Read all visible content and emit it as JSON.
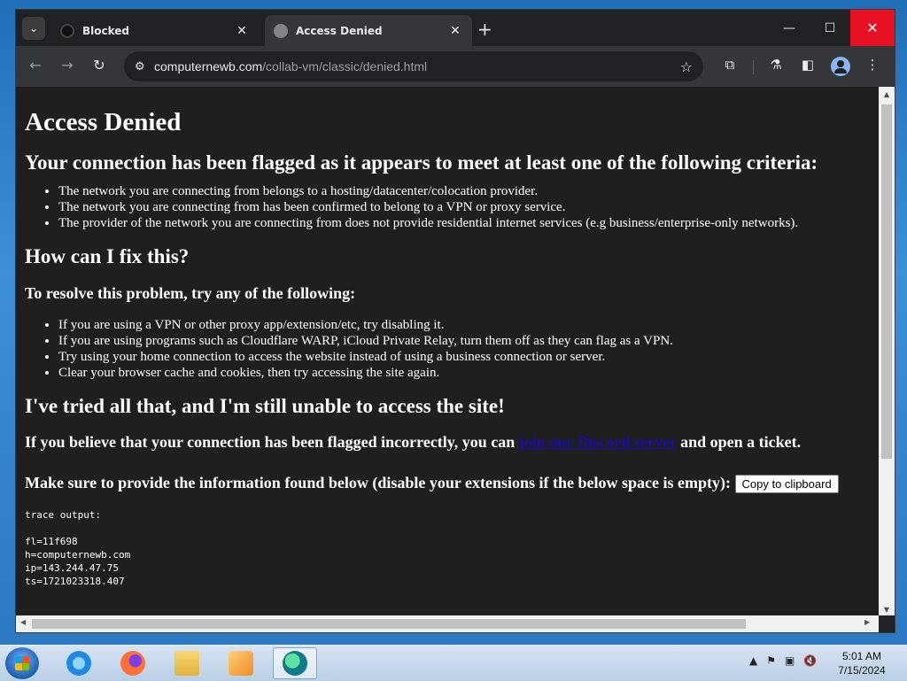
{
  "browser": {
    "tabs": [
      {
        "title": "Blocked",
        "active": false
      },
      {
        "title": "Access Denied",
        "active": true
      }
    ],
    "address_host": "computernewb.com",
    "address_path": "/collab-vm/classic/denied.html"
  },
  "page": {
    "title": "Access Denied",
    "criteria_heading": "Your connection has been flagged as it appears to meet at least one of the following criteria:",
    "criteria": [
      "The network you are connecting from belongs to a hosting/datacenter/colocation provider.",
      "The network you are connecting from has been confirmed to belong to a VPN or proxy service.",
      "The provider of the network you are connecting from does not provide residential internet services (e.g business/enterprise-only networks)."
    ],
    "fix_heading": "How can I fix this?",
    "resolve_heading": "To resolve this problem, try any of the following:",
    "fixes": [
      "If you are using a VPN or other proxy app/extension/etc, try disabling it.",
      "If you are using programs such as Cloudflare WARP, iCloud Private Relay, turn them off as they can flag as a VPN.",
      "Try using your home connection to access the website instead of using a business connection or server.",
      "Clear your browser cache and cookies, then try accessing the site again."
    ],
    "tried_heading": "I've tried all that, and I'm still unable to access the site!",
    "ticket_prefix": "If you believe that your connection has been flagged incorrectly, you can",
    "ticket_link": "join our Discord server",
    "ticket_suffix": "and open a ticket.",
    "info_text": "Make sure to provide the information found below (disable your extensions if the below space is empty):",
    "copy_button": "Copy to clipboard",
    "trace": "trace output:\n\nfl=11f698\nh=computernewb.com\nip=143.244.47.75\nts=1721023318.407"
  },
  "taskbar": {
    "time": "5:01 AM",
    "date": "7/15/2024"
  },
  "colors": {
    "page_bg": "#1f1f1f",
    "link": "#1a0dab",
    "close_red": "#e81123"
  }
}
